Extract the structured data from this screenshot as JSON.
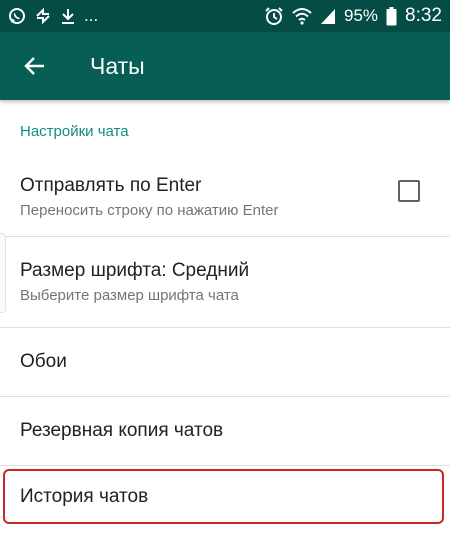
{
  "status_bar": {
    "more": "...",
    "battery": "95%",
    "time": "8:32"
  },
  "app_bar": {
    "title": "Чаты"
  },
  "section": {
    "header": "Настройки чата"
  },
  "settings": {
    "enter_send": {
      "title": "Отправлять по Enter",
      "subtitle": "Переносить строку по нажатию Enter",
      "checked": false
    },
    "font_size": {
      "title": "Размер шрифта: Средний",
      "subtitle": "Выберите размер шрифта чата"
    },
    "wallpaper": {
      "title": "Обои"
    },
    "backup": {
      "title": "Резервная копия чатов"
    },
    "history": {
      "title": "История чатов"
    }
  },
  "colors": {
    "status_bar": "#054d44",
    "app_bar": "#075e54",
    "accent": "#128c7e",
    "highlight": "#c62828"
  },
  "icons": [
    "whatsapp-icon",
    "sync-icon",
    "download-icon",
    "alarm-icon",
    "wifi-icon",
    "signal-icon",
    "battery-icon",
    "back-arrow-icon"
  ]
}
